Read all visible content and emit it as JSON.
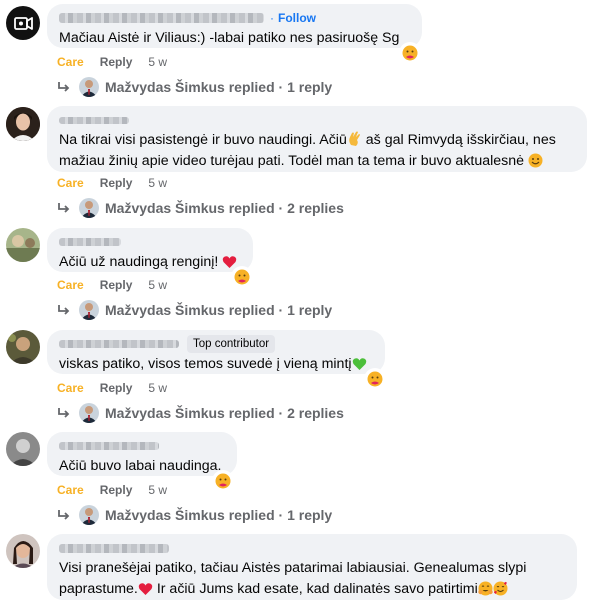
{
  "action_labels": {
    "care": "Care",
    "reply": "Reply"
  },
  "comments": [
    {
      "follow": "Follow",
      "badge": "",
      "text": "Mačiau Aistė ir Viliaus:) -labai patiko nes pasiruošę Sg",
      "time": "5 w",
      "replies": "Mažvydas Šimkus replied · 1 reply"
    },
    {
      "follow": "",
      "badge": "",
      "text": "Na tikrai visi pasistengė ir buvo naudingi. Ačiū",
      "text_b": " aš gal Rimvydą išskirčiau, nes mažiau žinių apie video turėjau pati. Todėl man ta tema ir buvo aktualesnė",
      "time": "5 w",
      "replies": "Mažvydas Šimkus replied · 2 replies"
    },
    {
      "follow": "",
      "badge": "",
      "text": "Ačiū už naudingą renginį!",
      "time": "5 w",
      "replies": "Mažvydas Šimkus replied · 1 reply"
    },
    {
      "follow": "",
      "badge": "Top contributor",
      "text": "viskas patiko, visos temos suvedė į vieną mintį",
      "time": "5 w",
      "replies": "Mažvydas Šimkus replied · 2 replies"
    },
    {
      "follow": "",
      "badge": "",
      "text": "Ačiū buvo labai naudinga.",
      "time": "5 w",
      "replies": "Mažvydas Šimkus replied · 1 reply"
    },
    {
      "follow": "",
      "badge": "",
      "text": "Visi pranešėjai patiko, tačiau Aistės patarimai labiausiai. Genealumas slypi paprastume.",
      "text_b": " Ir ačiū Jums kad esate, kad dalinatės savo patirtimi",
      "time": "",
      "replies": ""
    }
  ],
  "colors": {
    "care": "#f7b125",
    "link": "#1877f2",
    "meta": "#65676b",
    "bubble": "#f0f2f5"
  }
}
